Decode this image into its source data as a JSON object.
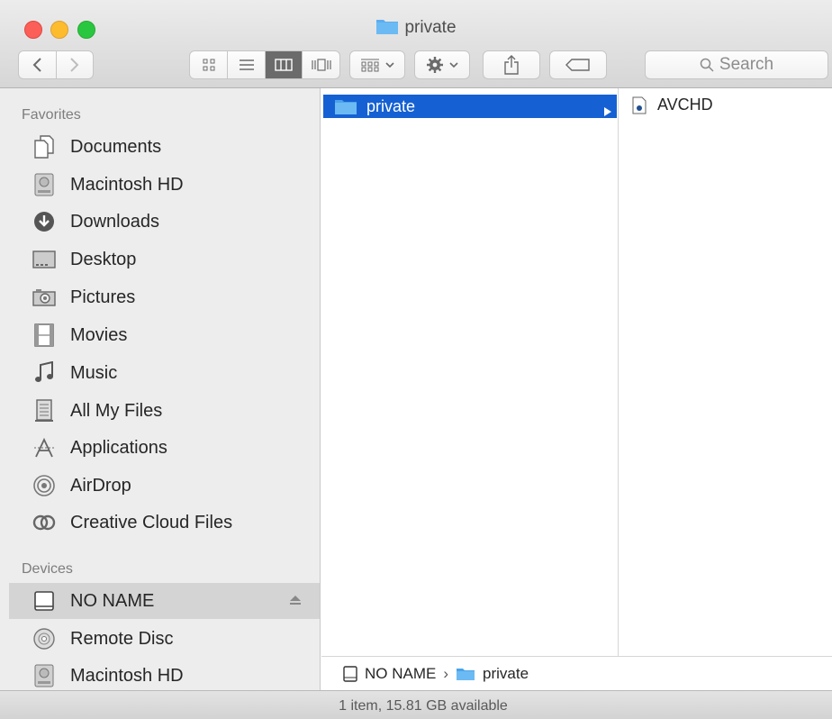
{
  "window": {
    "title": "private"
  },
  "toolbar": {
    "search_placeholder": "Search"
  },
  "sidebar": {
    "favorites_header": "Favorites",
    "favorites": [
      {
        "label": "Documents",
        "icon": "document-icon"
      },
      {
        "label": "Macintosh HD",
        "icon": "hard-drive-icon"
      },
      {
        "label": "Downloads",
        "icon": "download-icon"
      },
      {
        "label": "Desktop",
        "icon": "desktop-icon"
      },
      {
        "label": "Pictures",
        "icon": "camera-icon"
      },
      {
        "label": "Movies",
        "icon": "film-icon"
      },
      {
        "label": "Music",
        "icon": "music-note-icon"
      },
      {
        "label": "All My Files",
        "icon": "all-files-icon"
      },
      {
        "label": "Applications",
        "icon": "applications-icon"
      },
      {
        "label": "AirDrop",
        "icon": "airdrop-icon"
      },
      {
        "label": "Creative Cloud Files",
        "icon": "creative-cloud-icon"
      }
    ],
    "devices_header": "Devices",
    "devices": [
      {
        "label": "NO NAME",
        "icon": "drive-icon",
        "selected": true
      },
      {
        "label": "Remote Disc",
        "icon": "disc-icon"
      },
      {
        "label": "Macintosh HD",
        "icon": "hard-drive-icon"
      }
    ]
  },
  "columns": {
    "col1": [
      {
        "label": "private",
        "selected": true
      }
    ],
    "col2": [
      {
        "label": "AVCHD"
      }
    ]
  },
  "pathbar": {
    "root": "NO NAME",
    "current": "private"
  },
  "status": {
    "text": "1 item, 15.81 GB available"
  },
  "colors": {
    "selection": "#1561d3",
    "folder": "#5aaef0"
  }
}
